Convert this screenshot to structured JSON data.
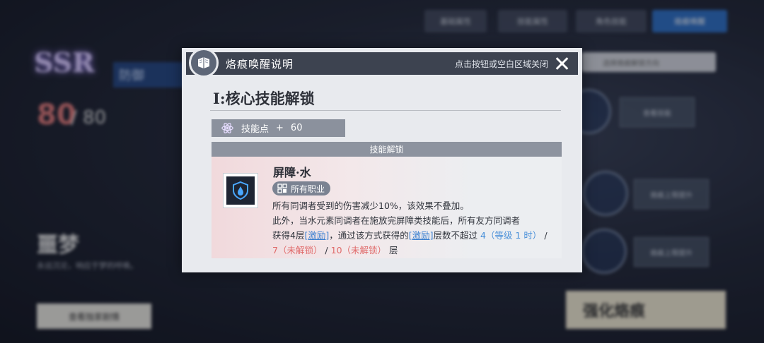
{
  "modal": {
    "title": "烙痕唤醒说明",
    "close_hint": "点击按钮或空白区域关闭",
    "section_title": "I:核心技能解锁",
    "skill_points": {
      "label": "技能点",
      "plus": "+",
      "value": "60"
    },
    "unlock_header": "技能解锁",
    "skill": {
      "name": "屏障·水",
      "job_tag": "所有职业",
      "desc_line1": "所有同调者受到的伤害减少10%，该效果不叠加。",
      "desc_line2": "此外，当水元素同调者在施放完屏障类技能后，所有友方同调者",
      "desc_seg1": "获得4层",
      "keyword1": "[激励]",
      "desc_seg2": "，通过该方式获得的",
      "keyword2": "[激励]",
      "desc_seg3": "层数不超过 ",
      "val_level1": "4（等级 1 时）",
      "sep1": " / ",
      "val_locked7": "7（未解锁）",
      "sep2": " / ",
      "val_locked10": "10（未解锁）",
      "desc_end": " 层"
    }
  },
  "background": {
    "tabs": [
      "基础属性",
      "技能属性",
      "角色技能",
      "烙痕唤醒"
    ],
    "rarity": "SSR",
    "role": "防御",
    "level": "80",
    "level_max": "/ 80",
    "name": "噩梦",
    "quote": "永远沉沦，响应于梦的呼唤。",
    "story_button": "查看独家剧情",
    "search_placeholder": "选择烙痕解锁方向",
    "enhance_button": "强化烙痕",
    "right_cards": [
      "查看技能",
      "烙痕上限提升",
      "烙痕上限提升"
    ]
  },
  "colors": {
    "modal_header": "#3d4350",
    "accent_blue": "#3a7fd0",
    "locked_red": "#e06a6a",
    "active_tab": "#2f6fc4"
  }
}
